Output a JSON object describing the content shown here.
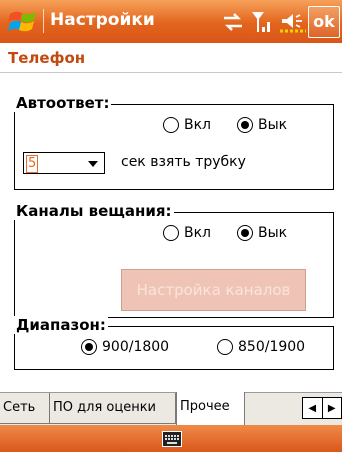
{
  "titlebar": {
    "title": "Настройки",
    "ok_label": "ok"
  },
  "page": {
    "title": "Телефон"
  },
  "autoanswer": {
    "legend": "Автоответ:",
    "on_label": "Вкл",
    "off_label": "Вык",
    "selected": "off",
    "rings_value": "5",
    "rings_suffix": "сек взять трубку"
  },
  "broadcast": {
    "legend": "Каналы вещания:",
    "on_label": "Вкл",
    "off_label": "Вык",
    "selected": "off",
    "settings_button": "Настройка каналов"
  },
  "band": {
    "legend": "Диапазон:",
    "option_a": "900/1800",
    "option_b": "850/1900",
    "selected": "900/1800"
  },
  "tabs": [
    {
      "label": "Сеть"
    },
    {
      "label": "ПО для оценки"
    },
    {
      "label": "Прочее",
      "active": true
    }
  ],
  "tab_scroll": {
    "left": "◀",
    "right": "▶"
  },
  "colors": {
    "accent": "#e2641c",
    "title_text": "#c24a10"
  },
  "icons": [
    "windows-start-icon",
    "connectivity-icon",
    "signal-icon",
    "volume-icon",
    "keyboard-icon"
  ]
}
